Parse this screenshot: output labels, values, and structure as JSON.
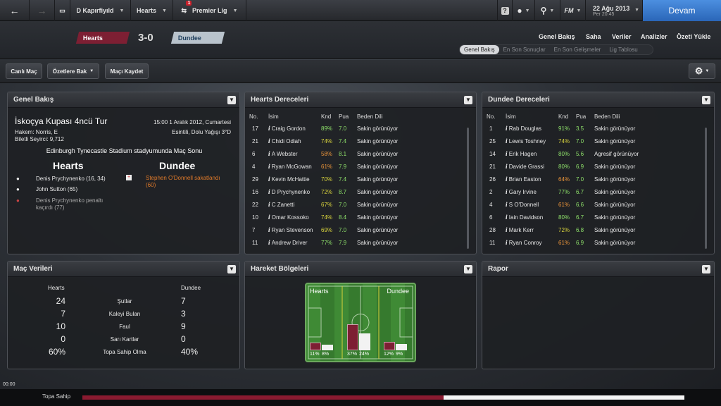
{
  "topbar": {
    "back_icon": "back-arrow-icon",
    "forward_icon": "forward-arrow-icon",
    "home_icon": "car-icon",
    "club": "D Kapırfiyıld",
    "team": "Hearts",
    "notifications": "1",
    "competition": "Premier Lig",
    "help": "?",
    "date": "22 Ağu 2013",
    "day_time": "Per 20:45",
    "continue": "Devam",
    "fm": "FM"
  },
  "match": {
    "home": "Hearts",
    "away": "Dundee",
    "score": "3-0"
  },
  "nav": {
    "links": [
      "Genel Bakış",
      "Saha",
      "Veriler",
      "Analizler",
      "Özeti Yükle"
    ],
    "subtabs": [
      "Genel Bakış",
      "En Son Sonuçlar",
      "En Son Gelişmeler",
      "Lig Tablosu"
    ]
  },
  "toolbar": {
    "live": "Canlı Maç",
    "highlights": "Özetlere Bak",
    "save": "Maçı Kaydet"
  },
  "overview": {
    "title": "Genel Bakış",
    "competition": "İskoçya Kupası 4ncü Tur",
    "datetime": "15:00 1 Aralık 2012, Cumartesi",
    "referee": "Hakem: Norris, E",
    "weather": "Esintili, Dolu Yağışı 3°D",
    "attendance": "Biletli Seyirci: 9,712",
    "venue": "Edinburgh Tynecastle Stadium stadyumunda Maç Sonu",
    "home": "Hearts",
    "away": "Dundee",
    "home_events": [
      "Denis Prychynenko (16, 34)",
      "John Sutton (65)",
      "Denis Prychynenko penaltı kaçırdı (77)"
    ],
    "away_events": [
      "Stephen O'Donnell sakatlandı (60)"
    ]
  },
  "headers": {
    "no": "No.",
    "name": "İsim",
    "cond": "Knd",
    "rating": "Pua",
    "body": "Beden Dili"
  },
  "hearts_ratings": {
    "title": "Hearts Dereceleri",
    "rows": [
      {
        "no": "17",
        "name": "Craig Gordon",
        "cond": "89%",
        "rating": "7.0",
        "body": "Sakin görünüyor"
      },
      {
        "no": "21",
        "name": "Chidi Odiah",
        "cond": "74%",
        "rating": "7.4",
        "body": "Sakin görünüyor"
      },
      {
        "no": "6",
        "name": "A Webster",
        "cond": "58%",
        "rating": "8.1",
        "body": "Sakin görünüyor"
      },
      {
        "no": "4",
        "name": "Ryan McGowan",
        "cond": "61%",
        "rating": "7.9",
        "body": "Sakin görünüyor"
      },
      {
        "no": "29",
        "name": "Kevin McHattie",
        "cond": "70%",
        "rating": "7.4",
        "body": "Sakin görünüyor"
      },
      {
        "no": "16",
        "name": "D Prychynenko",
        "cond": "72%",
        "rating": "8.7",
        "body": "Sakin görünüyor"
      },
      {
        "no": "22",
        "name": "C Zanetti",
        "cond": "67%",
        "rating": "7.0",
        "body": "Sakin görünüyor"
      },
      {
        "no": "10",
        "name": "Omar Kossoko",
        "cond": "74%",
        "rating": "8.4",
        "body": "Sakin görünüyor"
      },
      {
        "no": "7",
        "name": "Ryan Stevenson",
        "cond": "69%",
        "rating": "7.0",
        "body": "Sakin görünüyor"
      },
      {
        "no": "11",
        "name": "Andrew Driver",
        "cond": "77%",
        "rating": "7.9",
        "body": "Sakin görünüyor"
      }
    ]
  },
  "dundee_ratings": {
    "title": "Dundee Dereceleri",
    "rows": [
      {
        "no": "1",
        "name": "Rab Douglas",
        "cond": "91%",
        "rating": "3.5",
        "body": "Sakin görünüyor"
      },
      {
        "no": "25",
        "name": "Lewis Toshney",
        "cond": "74%",
        "rating": "7.0",
        "body": "Sakin görünüyor"
      },
      {
        "no": "14",
        "name": "Erik Hagen",
        "cond": "80%",
        "rating": "5.6",
        "body": "Agresif görünüyor"
      },
      {
        "no": "21",
        "name": "Davide Grassi",
        "cond": "80%",
        "rating": "6.9",
        "body": "Sakin görünüyor"
      },
      {
        "no": "26",
        "name": "Brian Easton",
        "cond": "64%",
        "rating": "7.0",
        "body": "Sakin görünüyor"
      },
      {
        "no": "2",
        "name": "Gary Irvine",
        "cond": "77%",
        "rating": "6.7",
        "body": "Sakin görünüyor"
      },
      {
        "no": "4",
        "name": "S O'Donnell",
        "cond": "61%",
        "rating": "6.6",
        "body": "Sakin görünüyor"
      },
      {
        "no": "6",
        "name": "Iain Davidson",
        "cond": "80%",
        "rating": "6.7",
        "body": "Sakin görünüyor"
      },
      {
        "no": "28",
        "name": "Mark Kerr",
        "cond": "72%",
        "rating": "6.8",
        "body": "Sakin görünüyor"
      },
      {
        "no": "11",
        "name": "Ryan Conroy",
        "cond": "61%",
        "rating": "6.9",
        "body": "Sakin görünüyor"
      }
    ]
  },
  "stats": {
    "title": "Maç Verileri",
    "home": "Hearts",
    "away": "Dundee",
    "rows": [
      {
        "label": "Şutlar",
        "home": "24",
        "away": "7"
      },
      {
        "label": "Kaleyi Bulan",
        "home": "7",
        "away": "3"
      },
      {
        "label": "Faul",
        "home": "10",
        "away": "9"
      },
      {
        "label": "Sarı Kartlar",
        "home": "0",
        "away": "0"
      },
      {
        "label": "Topa Sahip Olma",
        "home": "60%",
        "away": "40%"
      }
    ]
  },
  "zones": {
    "title": "Hareket Bölgeleri",
    "home": "Hearts",
    "away": "Dundee",
    "bars": [
      {
        "home": "11%",
        "away": "8%",
        "home_value": 11,
        "away_value": 8
      },
      {
        "home": "37%",
        "away": "24%",
        "home_value": 37,
        "away_value": 24
      },
      {
        "home": "12%",
        "away": "9%",
        "home_value": 12,
        "away_value": 9
      }
    ]
  },
  "report": {
    "title": "Rapor"
  },
  "footer": {
    "time": "00:00",
    "label": "Topa Sahip",
    "possession_home": 60
  }
}
